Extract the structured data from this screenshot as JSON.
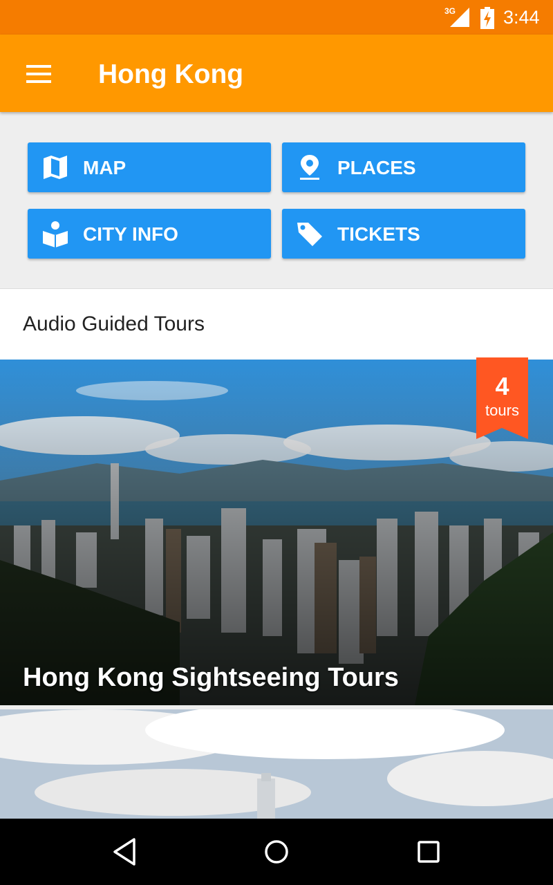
{
  "status_bar": {
    "network": "3G",
    "time": "3:44",
    "icons": [
      "signal-icon",
      "battery-charging-icon"
    ]
  },
  "app_bar": {
    "title": "Hong Kong",
    "menu_icon": "hamburger-menu-icon"
  },
  "actions": [
    {
      "label": "MAP",
      "icon": "map-icon"
    },
    {
      "label": "PLACES",
      "icon": "place-pin-icon"
    },
    {
      "label": "CITY INFO",
      "icon": "city-info-book-icon"
    },
    {
      "label": "TICKETS",
      "icon": "ticket-tag-icon"
    }
  ],
  "tours_section": {
    "title": "Audio Guided Tours"
  },
  "tour_cards": [
    {
      "name": "Hong Kong Sightseeing Tours",
      "badge": {
        "count": "4",
        "unit": "tours"
      }
    },
    {
      "name": ""
    }
  ],
  "nav_bar": {
    "buttons": [
      "back-icon",
      "home-icon",
      "recents-icon"
    ]
  },
  "colors": {
    "status_bar": "#f57c00",
    "app_bar": "#ff9800",
    "action_button": "#2196f3",
    "badge": "#ff5722",
    "background": "#eeeeee"
  }
}
